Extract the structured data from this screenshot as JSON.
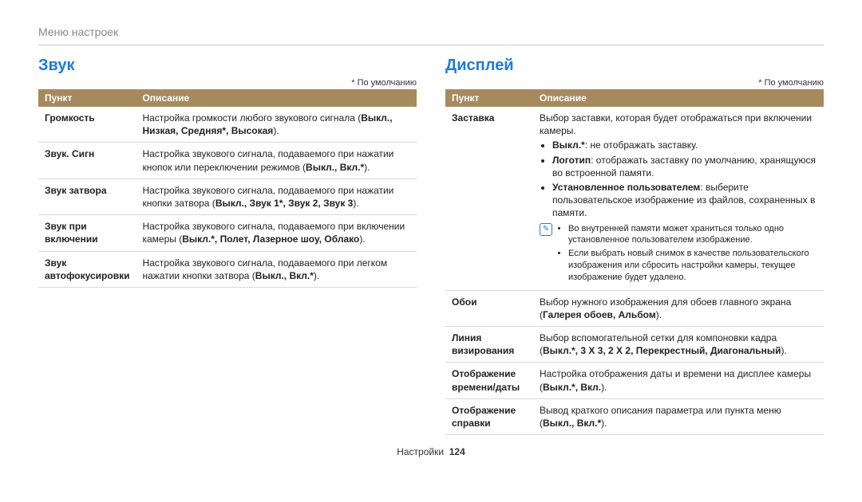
{
  "breadcrumb": "Меню настроек",
  "default_note": "* По умолчанию",
  "header_item": "Пункт",
  "header_desc": "Описание",
  "footer_section": "Настройки",
  "footer_page": "124",
  "sound": {
    "title": "Звук",
    "rows": {
      "volume": {
        "label": "Громкость",
        "pre": "Настройка громкости любого звукового сигнала (",
        "opts": "Выкл., Низкая, Средняя*, Высокая",
        "post": ")."
      },
      "beep": {
        "label": "Звук. Сигн",
        "pre": "Настройка звукового сигнала, подаваемого при нажатии кнопок или переключении режимов (",
        "opts": "Выкл., Вкл.*",
        "post": ")."
      },
      "shutter": {
        "label": "Звук затвора",
        "pre": "Настройка звукового сигнала, подаваемого при нажатии кнопки затвора (",
        "opts": "Выкл., Звук 1*, Звук 2, Звук 3",
        "post": ")."
      },
      "startup": {
        "label": "Звук при включении",
        "pre": "Настройка звукового сигнала, подаваемого при включении камеры (",
        "opts": "Выкл.*, Полет, Лазерное шоу, Облако",
        "post": ")."
      },
      "af": {
        "label": "Звук автофокусировки",
        "pre": "Настройка звукового сигнала, подаваемого при легком нажатии кнопки затвора (",
        "opts": "Выкл., Вкл.*",
        "post": ")."
      }
    }
  },
  "display": {
    "title": "Дисплей",
    "rows": {
      "splash": {
        "label": "Заставка",
        "intro": "Выбор заставки, которая будет отображаться при включении камеры.",
        "b1_k": "Выкл.*",
        "b1_v": ": не отображать заставку.",
        "b2_k": "Логотип",
        "b2_v": ": отображать заставку по умолчанию, хранящуюся во встроенной памяти.",
        "b3_k": "Установленное пользователем",
        "b3_v": ": выберите пользовательское изображение из файлов, сохраненных в памяти.",
        "note1": "Во внутренней памяти может храниться только одно установленное пользователем изображение.",
        "note2": "Если выбрать новый снимок в качестве пользовательского изображения или сбросить настройки камеры, текущее изображение будет удалено."
      },
      "wallpaper": {
        "label": "Обои",
        "pre": "Выбор нужного изображения для обоев главного экрана (",
        "opts": "Галерея обоев, Альбом",
        "post": ")."
      },
      "grid": {
        "label": "Линия визирования",
        "pre": "Выбор вспомогательной сетки для компоновки кадра (",
        "opts": "Выкл.*, 3 X 3, 2 X 2, Перекрестный, Диагональный",
        "post": ")."
      },
      "datetime": {
        "label": "Отображение времени/даты",
        "pre": "Настройка отображения даты и времени на дисплее камеры (",
        "opts": "Выкл.*, Вкл.",
        "post": ")."
      },
      "help": {
        "label": "Отображение справки",
        "pre": "Вывод краткого описания параметра или пункта меню (",
        "opts": "Выкл., Вкл.*",
        "post": ")."
      }
    }
  }
}
